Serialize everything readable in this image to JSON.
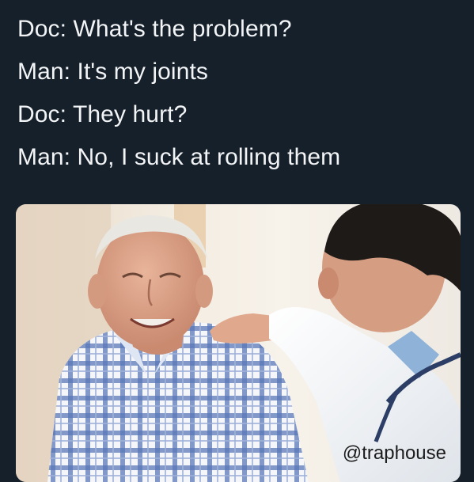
{
  "caption": {
    "lines": [
      "Doc: What's the problem?",
      "Man: It's my joints",
      "Doc: They hurt?",
      "Man: No, I suck at rolling them"
    ]
  },
  "photo": {
    "subject": "doctor-consultation-photo",
    "watermark": "@traphouse"
  }
}
